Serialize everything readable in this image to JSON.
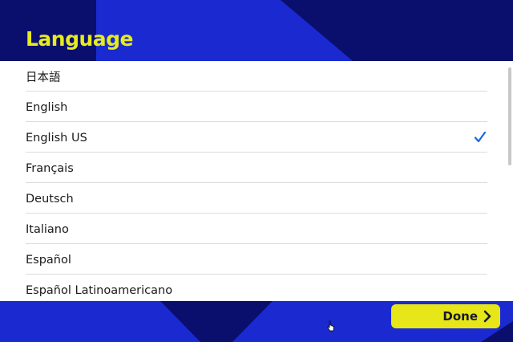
{
  "header": {
    "title": "Language"
  },
  "languages": [
    {
      "label": "日本語",
      "selected": false
    },
    {
      "label": "English",
      "selected": false
    },
    {
      "label": "English US",
      "selected": true
    },
    {
      "label": "Français",
      "selected": false
    },
    {
      "label": "Deutsch",
      "selected": false
    },
    {
      "label": "Italiano",
      "selected": false
    },
    {
      "label": "Español",
      "selected": false
    },
    {
      "label": "Español Latinoamericano",
      "selected": false
    }
  ],
  "footer": {
    "done_label": "Done",
    "done_icon": "chevron-right-icon"
  },
  "colors": {
    "title": "#e6ec1e",
    "background_dark": "#0a0f6e",
    "background_accent": "#1a2ad0",
    "check": "#1a66e0",
    "done_button": "#e6e618"
  }
}
